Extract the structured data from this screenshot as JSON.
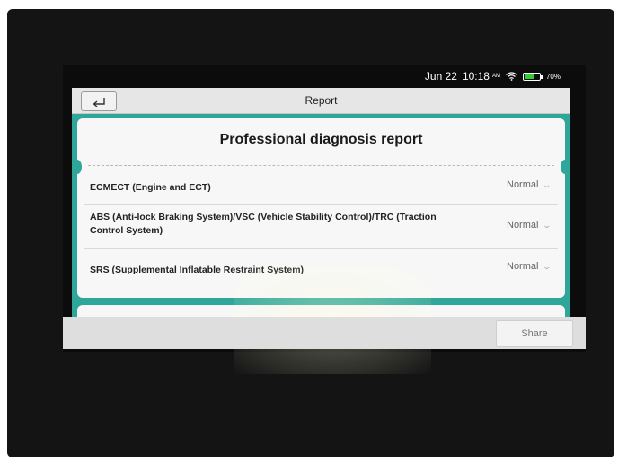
{
  "status_bar": {
    "date": "Jun 22",
    "time": "10:18",
    "ampm": "AM",
    "battery_percent": "70%",
    "battery_level": 0.7,
    "icons": [
      "wifi-icon",
      "battery-icon"
    ]
  },
  "titlebar": {
    "title": "Report",
    "back_icon": "back-arrow-icon"
  },
  "report": {
    "heading": "Professional diagnosis report",
    "rows": [
      {
        "label": "ECMECT (Engine and ECT)",
        "status": "Normal"
      },
      {
        "label": "ABS (Anti-lock Braking System)/VSC (Vehicle Stability Control)/TRC (Traction Control System)",
        "status": "Normal"
      },
      {
        "label": "SRS (Supplemental Inflatable Restraint System)",
        "status": "Normal"
      }
    ]
  },
  "bottom_bar": {
    "share_label": "Share"
  },
  "colors": {
    "accent": "#2ea79a",
    "battery": "#33cc33"
  }
}
